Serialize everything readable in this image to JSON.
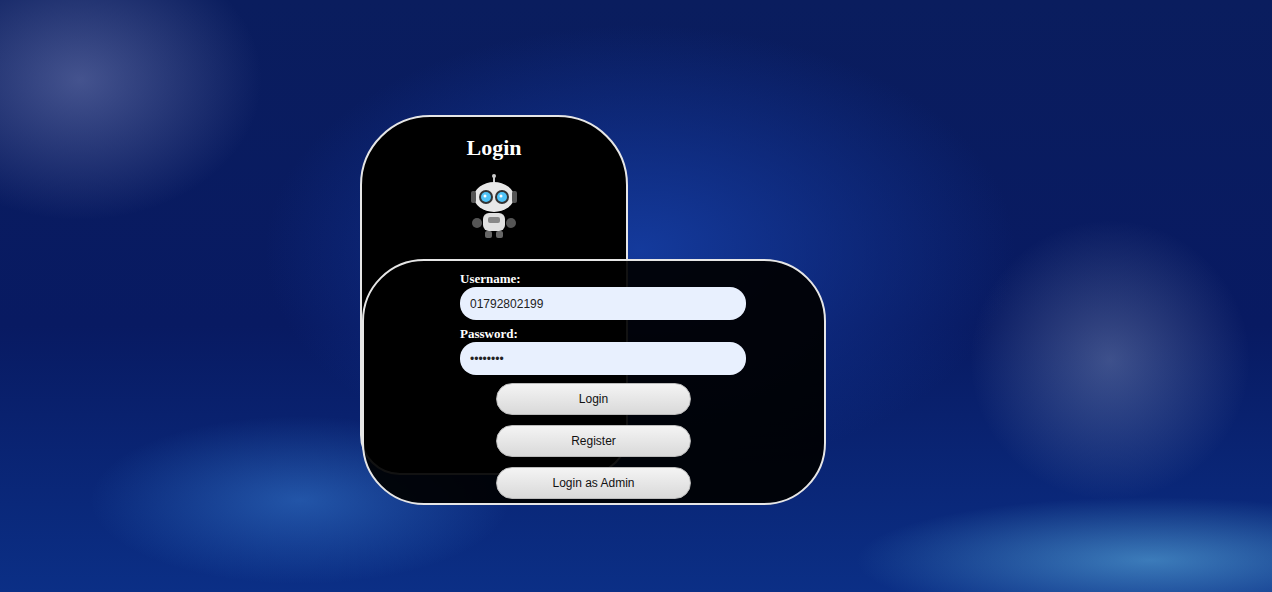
{
  "login": {
    "title": "Login",
    "fields": [
      {
        "label": "Username:",
        "value": "01792802199"
      },
      {
        "label": "Password:",
        "value": "••••••••"
      }
    ],
    "buttons": [
      "Login",
      "Register",
      "Login as Admin"
    ]
  }
}
